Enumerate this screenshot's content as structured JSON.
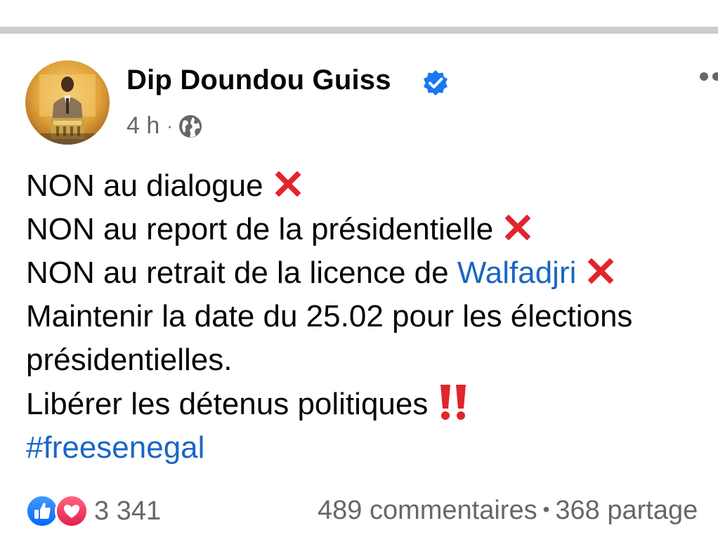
{
  "post": {
    "author": "Dip Doundou Guiss",
    "verified_icon": "verified-badge-icon",
    "time": "4 h",
    "time_separator": "·",
    "audience_icon": "globe-icon",
    "more_icon": "more-options-icon",
    "lines": [
      {
        "text": "NON au dialogue",
        "emoji": "cross-mark-emoji"
      },
      {
        "text": "NON au report de la présidentielle",
        "emoji": "cross-mark-emoji"
      },
      {
        "text": "NON au retrait de la licence de ",
        "link": "Walfadjri",
        "emoji": "cross-mark-emoji"
      },
      {
        "text": "Maintenir la date du 25.02 pour les élections présidentielles."
      },
      {
        "text": "Libérer les détenus politiques",
        "emoji": "double-exclamation-emoji"
      }
    ],
    "hashtag": "#freesenegal"
  },
  "footer": {
    "reaction_icons": [
      "like-reaction-icon",
      "love-reaction-icon"
    ],
    "reaction_count": "3 341",
    "comments": "489 commentaires",
    "separator": "•",
    "shares": "368 partage"
  },
  "colors": {
    "text": "#050505",
    "secondary": "#65676b",
    "link": "#1a66c4",
    "verified": "#1877f2",
    "cross": "#e0252b",
    "divider": "#c9ccd1"
  }
}
